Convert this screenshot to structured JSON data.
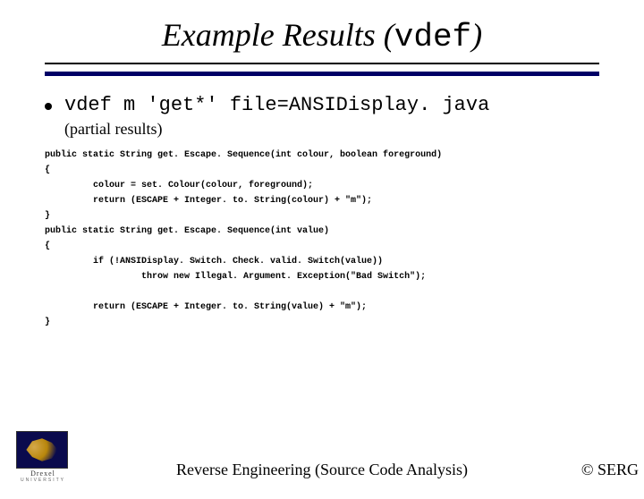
{
  "title_prefix": "Example Results (",
  "title_mono": "vdef",
  "title_suffix": ")",
  "command": "vdef m 'get*' file=ANSIDisplay. java",
  "subnote": "(partial results)",
  "code": "public static String get. Escape. Sequence(int colour, boolean foreground)\n{\n         colour = set. Colour(colour, foreground);\n         return (ESCAPE + Integer. to. String(colour) + \"m\");\n}\npublic static String get. Escape. Sequence(int value)\n{\n         if (!ANSIDisplay. Switch. Check. valid. Switch(value))\n                  throw new Illegal. Argument. Exception(\"Bad Switch\");\n\n         return (ESCAPE + Integer. to. String(value) + \"m\");\n}",
  "logo": {
    "name": "Drexel",
    "sub": "UNIVERSITY"
  },
  "footer_center": "Reverse Engineering (Source Code Analysis)",
  "footer_right": "© SERG"
}
